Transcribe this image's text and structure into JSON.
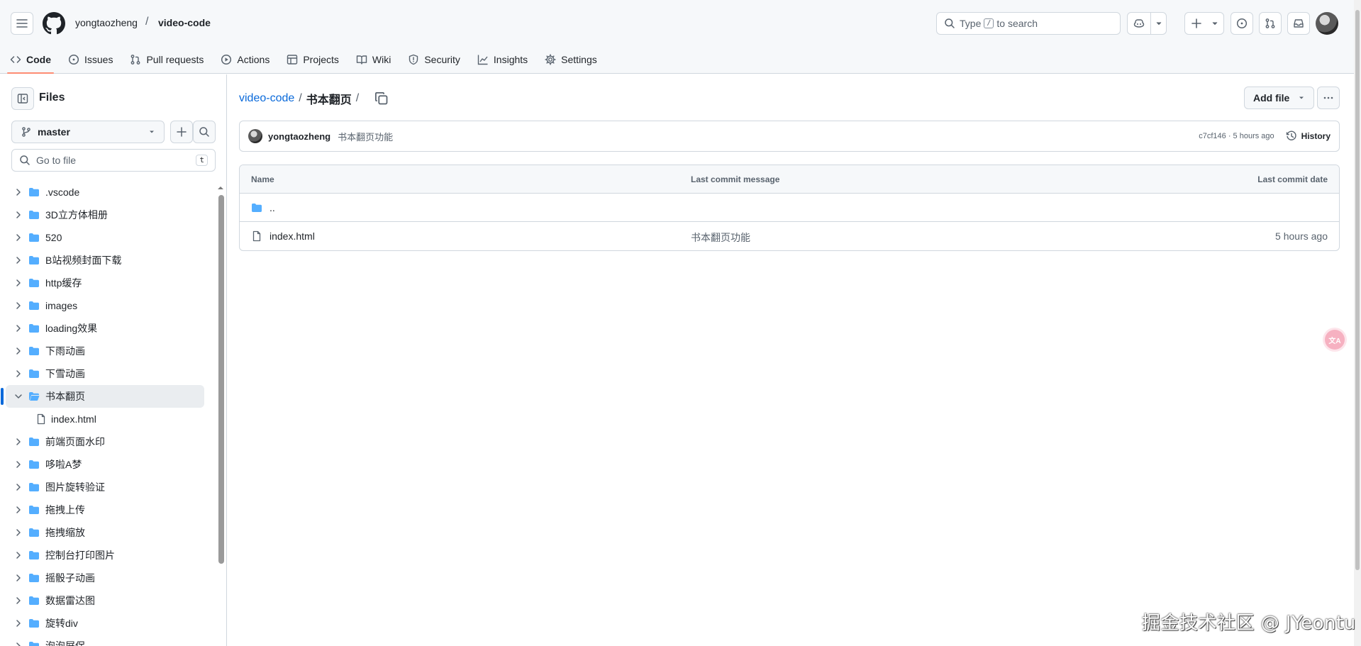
{
  "header": {
    "owner": "yongtaozheng",
    "separator": "/",
    "repo": "video-code",
    "search": {
      "prefix": "Type",
      "key": "/",
      "suffix": "to search"
    }
  },
  "nav": {
    "tabs": [
      {
        "label": "Code",
        "icon": "code-icon",
        "active": true
      },
      {
        "label": "Issues",
        "icon": "issue-icon"
      },
      {
        "label": "Pull requests",
        "icon": "pull-request-icon"
      },
      {
        "label": "Actions",
        "icon": "play-icon"
      },
      {
        "label": "Projects",
        "icon": "table-icon"
      },
      {
        "label": "Wiki",
        "icon": "book-icon"
      },
      {
        "label": "Security",
        "icon": "shield-icon"
      },
      {
        "label": "Insights",
        "icon": "graph-icon"
      },
      {
        "label": "Settings",
        "icon": "gear-icon"
      }
    ]
  },
  "sidebar": {
    "title": "Files",
    "branch": "master",
    "goto_placeholder": "Go to file",
    "goto_key": "t",
    "tree": [
      {
        "label": ".vscode",
        "type": "folder"
      },
      {
        "label": "3D立方体相册",
        "type": "folder"
      },
      {
        "label": "520",
        "type": "folder"
      },
      {
        "label": "B站视频封面下载",
        "type": "folder"
      },
      {
        "label": "http缓存",
        "type": "folder"
      },
      {
        "label": "images",
        "type": "folder"
      },
      {
        "label": "loading效果",
        "type": "folder"
      },
      {
        "label": "下雨动画",
        "type": "folder"
      },
      {
        "label": "下雪动画",
        "type": "folder"
      },
      {
        "label": "书本翻页",
        "type": "folder",
        "expanded": true,
        "selected": true
      },
      {
        "label": "index.html",
        "type": "file",
        "child": true
      },
      {
        "label": "前端页面水印",
        "type": "folder"
      },
      {
        "label": "哆啦A梦",
        "type": "folder"
      },
      {
        "label": "图片旋转验证",
        "type": "folder"
      },
      {
        "label": "拖拽上传",
        "type": "folder"
      },
      {
        "label": "拖拽缩放",
        "type": "folder"
      },
      {
        "label": "控制台打印图片",
        "type": "folder"
      },
      {
        "label": "摇骰子动画",
        "type": "folder"
      },
      {
        "label": "数据雷达图",
        "type": "folder"
      },
      {
        "label": "旋转div",
        "type": "folder"
      },
      {
        "label": "泡泡屏保",
        "type": "folder"
      }
    ]
  },
  "main": {
    "breadcrumb": {
      "repo": "video-code",
      "sep": "/",
      "current": "书本翻页",
      "trailing": "/"
    },
    "add_file": "Add file",
    "commit": {
      "author": "yongtaozheng",
      "message": "书本翻页功能",
      "meta": "c7cf146 · 5 hours ago",
      "history": "History"
    },
    "table": {
      "headers": [
        "Name",
        "Last commit message",
        "Last commit date"
      ],
      "rows": [
        {
          "name": "..",
          "type": "folder",
          "message": "",
          "date": ""
        },
        {
          "name": "index.html",
          "type": "file",
          "message": "书本翻页功能",
          "date": "5 hours ago"
        }
      ]
    }
  },
  "overlay": {
    "translate_glyph": "文A",
    "watermark": "掘金技术社区 @ JYeontu"
  },
  "colors": {
    "accent": "#0969da",
    "folder": "#54aeff",
    "tab_underline": "#fd8c73"
  }
}
